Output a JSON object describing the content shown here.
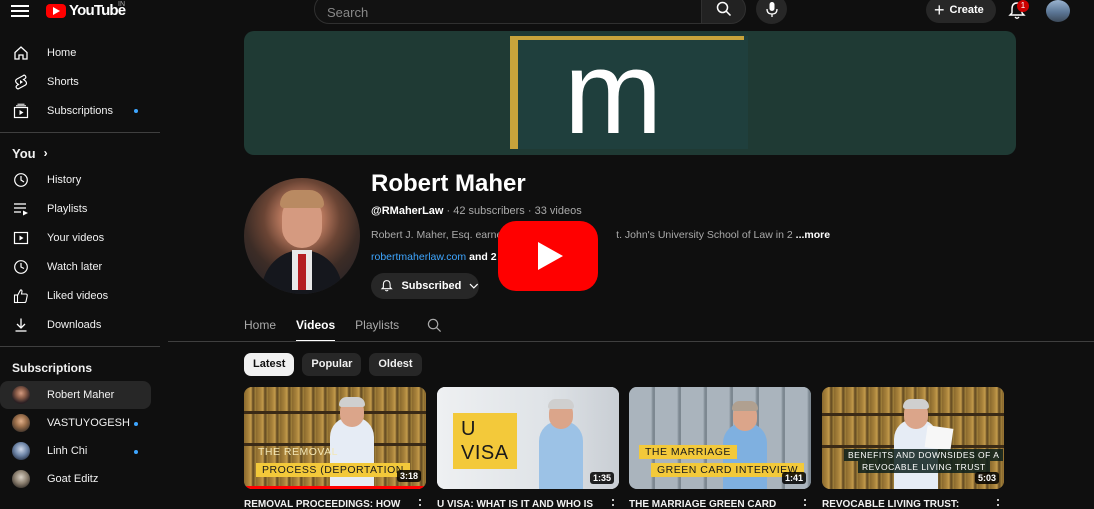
{
  "header": {
    "logo_text": "YouTube",
    "region": "IN",
    "search_placeholder": "Search",
    "create_label": "Create",
    "notification_count": "1"
  },
  "sidebar": {
    "main_items": [
      {
        "label": "Home",
        "icon": "home-icon"
      },
      {
        "label": "Shorts",
        "icon": "shorts-icon"
      },
      {
        "label": "Subscriptions",
        "icon": "subscriptions-icon",
        "dot": true
      }
    ],
    "you_label": "You",
    "you_items": [
      {
        "label": "History",
        "icon": "history-icon"
      },
      {
        "label": "Playlists",
        "icon": "playlists-icon"
      },
      {
        "label": "Your videos",
        "icon": "your-videos-icon"
      },
      {
        "label": "Watch later",
        "icon": "watch-later-icon"
      },
      {
        "label": "Liked videos",
        "icon": "liked-videos-icon"
      },
      {
        "label": "Downloads",
        "icon": "downloads-icon"
      }
    ],
    "subscriptions_title": "Subscriptions",
    "subscriptions": [
      {
        "label": "Robert Maher",
        "active": true,
        "dot": false
      },
      {
        "label": "VASTUYOGESH",
        "active": false,
        "dot": true
      },
      {
        "label": "Linh Chi",
        "active": false,
        "dot": true
      },
      {
        "label": "Goat Editz",
        "active": false,
        "dot": false
      }
    ]
  },
  "channel": {
    "banner_letter": "m",
    "name": "Robert Maher",
    "handle": "@RMaherLaw",
    "subscribers": "42 subscribers",
    "videos": "33 videos",
    "description_start": "Robert J. Maher, Esq. earned",
    "description_end": "t. John's University School of Law in 2",
    "more_label": "...more",
    "link": "robertmaherlaw.com",
    "other_links": "and 2 n",
    "subscribed_label": "Subscribed"
  },
  "tabs": [
    {
      "label": "Home",
      "active": false
    },
    {
      "label": "Videos",
      "active": true
    },
    {
      "label": "Playlists",
      "active": false
    }
  ],
  "chips": [
    {
      "label": "Latest",
      "active": true
    },
    {
      "label": "Popular",
      "active": false
    },
    {
      "label": "Oldest",
      "active": false
    }
  ],
  "videos": [
    {
      "caption_lines": [
        "THE REMOVAL",
        "PROCESS (DEPORTATION"
      ],
      "duration": "3:18",
      "title": "REMOVAL PROCEEDINGS: How",
      "progress": 1.0
    },
    {
      "caption_lines": [
        "U",
        "VISA"
      ],
      "duration": "1:35",
      "title": "U VISA: What is it and who is",
      "progress": 0
    },
    {
      "caption_lines": [
        "THE MARRIAGE",
        "GREEN CARD INTERVIEW"
      ],
      "duration": "1:41",
      "title": "THE MARRIAGE GREEN CARD",
      "progress": 0
    },
    {
      "caption_lines": [
        "BENEFITS AND DOWNSIDES OF A",
        "REVOCABLE LIVING TRUST"
      ],
      "duration": "5:03",
      "title": "REVOCABLE LIVING TRUST:",
      "progress": 0
    }
  ],
  "colors": {
    "background": "#0f0f0f",
    "accent_red": "#ff0000",
    "link_blue": "#3ea6ff",
    "banner_green": "#1f3a34",
    "banner_gold": "#c8a33b",
    "caption_yellow": "#f3c93a"
  }
}
